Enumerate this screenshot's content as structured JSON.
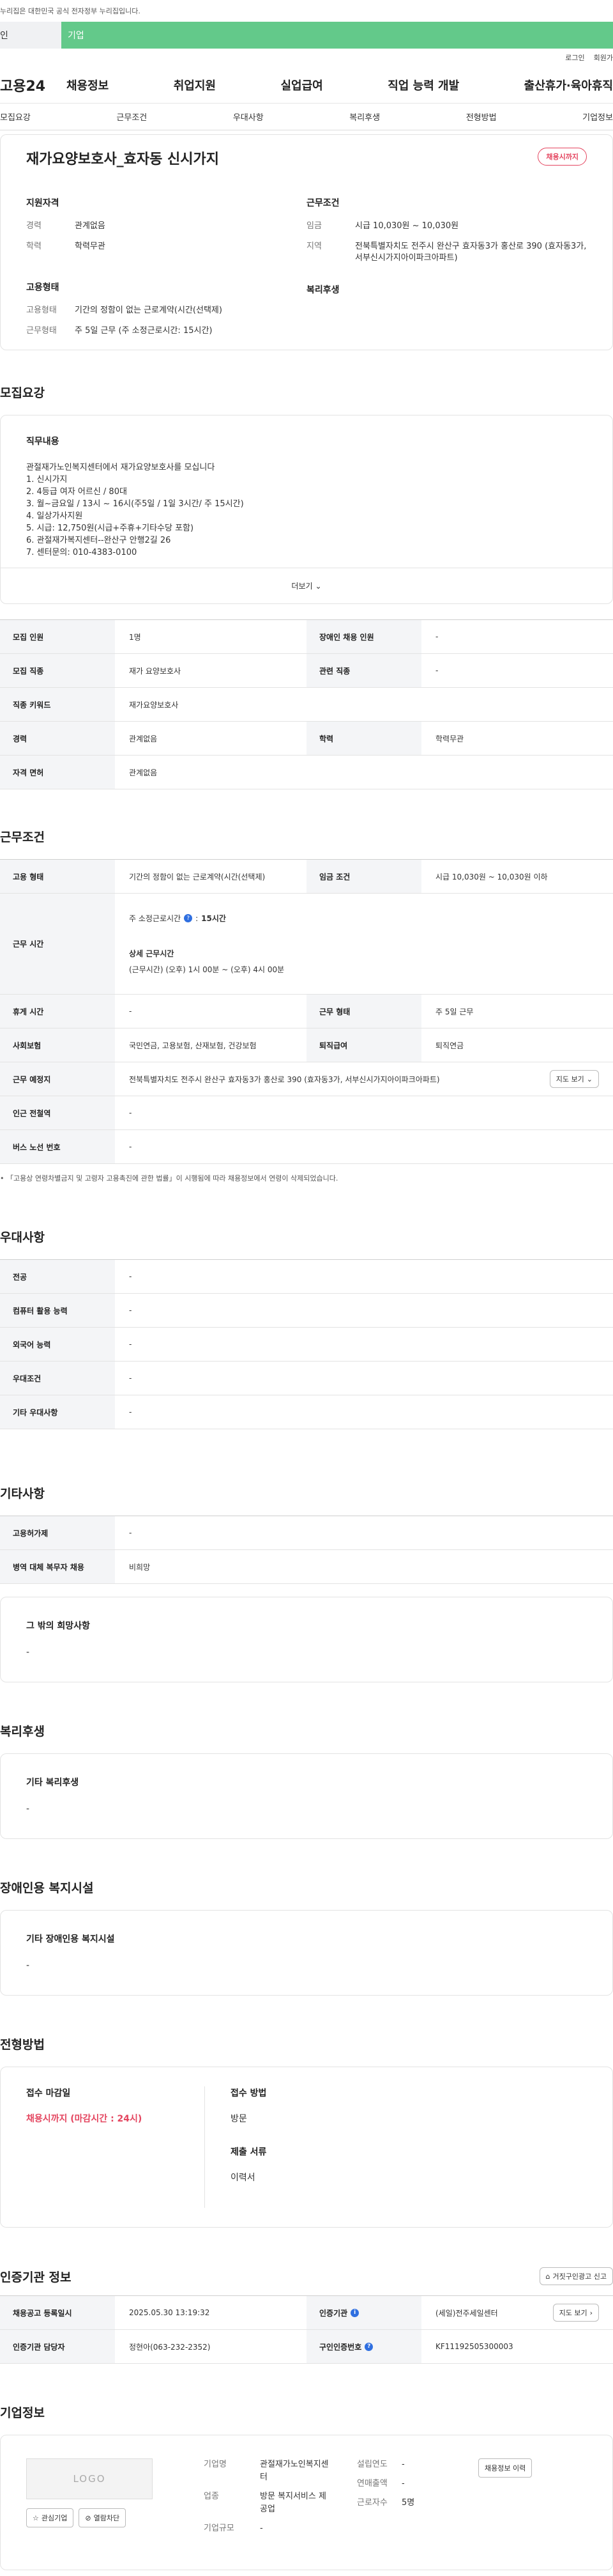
{
  "banner": {
    "text": "누리집은 대한민국 공식 전자정부 누리집입니다."
  },
  "user_tabs": {
    "personal": "인",
    "company": "기업"
  },
  "util": {
    "login": "로그인",
    "join": "회원가"
  },
  "gnb": {
    "logo": "고용24",
    "items": [
      "채용정보",
      "취업지원",
      "실업급여",
      "직업 능력 개발",
      "출산휴가·육아휴직"
    ]
  },
  "subnav": {
    "items": [
      "모집요강",
      "근무조건",
      "우대사항",
      "복리후생",
      "전형방법",
      "기업정보"
    ]
  },
  "summary": {
    "title": "재가요양보호사_효자동 신시가지",
    "badge": "채용시까지",
    "qual_title": "지원자격",
    "qual": [
      {
        "k": "경력",
        "v": "관계없음"
      },
      {
        "k": "학력",
        "v": "학력무관"
      }
    ],
    "work_title": "근무조건",
    "work": [
      {
        "k": "임금",
        "v": "시급 10,030원 ~ 10,030원"
      },
      {
        "k": "지역",
        "v": "전북특별자치도 전주시 완산구 효자동3가 홍산로 390 (효자동3가, 서부신시가지아이파크아파트)"
      }
    ],
    "emp_title": "고용형태",
    "emp": [
      {
        "k": "고용형태",
        "v": "기간의 정함이 없는 근로계약(시간(선택제)"
      },
      {
        "k": "근무형태",
        "v": "주 5일 근무 (주 소정근로시간: 15시간)"
      }
    ],
    "welfare_title": "복리후생"
  },
  "recruit": {
    "section": "모집요강",
    "desc_title": "직무내용",
    "desc_lines": [
      "관절재가노인복지센터에서 재가요양보호사를 모십니다",
      "1. 신시가지",
      "2. 4등급 여자 어르신 / 80대",
      "3. 월~금요일 / 13시 ~ 16시(주5일 / 1일 3시간/ 주 15시간)",
      "4. 일상가사지원",
      "5. 시급: 12,750원(시급+주휴+기타수당 포함)",
      "6. 관절재가복지센터--완산구 안행2길 26",
      "7. 센터문의: 010-4383-0100"
    ],
    "more": "더보기",
    "rows": [
      {
        "th1": "모집 인원",
        "td1": "1명",
        "th2": "장애인 채용 인원",
        "td2": "-"
      },
      {
        "th1": "모집 직종",
        "td1": "재가 요양보호사",
        "th2": "관련 직종",
        "td2": "-"
      },
      {
        "th1": "직종 키워드",
        "td1": "재가요양보호사"
      },
      {
        "th1": "경력",
        "td1": "관계없음",
        "th2": "학력",
        "td2": "학력무관"
      },
      {
        "th1": "자격 면허",
        "td1": "관계없음"
      }
    ]
  },
  "conditions": {
    "section": "근무조건",
    "emp_type_th": "고용 형태",
    "emp_type": "기간의 정함이 없는 근로계약(시간(선택제)",
    "wage_th": "임금 조건",
    "wage": "시급 10,030원 ~ 10,030원 이하",
    "hours_th": "근무 시간",
    "weekly_label": "주 소정근로시간",
    "weekly_value": "15시간",
    "detail_label": "상세 근무시간",
    "detail_value": "(근무시간) (오후) 1시 00분 ~ (오후) 4시 00분",
    "break_th": "휴게 시간",
    "break": "-",
    "form_th": "근무 형태",
    "form": "주 5일 근무",
    "insurance_th": "사회보험",
    "insurance": "국민연금, 고용보험, 산재보험, 건강보험",
    "severance_th": "퇴직급여",
    "severance": "퇴직연금",
    "location_th": "근무 예정지",
    "location": "전북특별자치도 전주시 완산구 효자동3가 홍산로 390 (효자동3가, 서부신시가지아이파크아파트)",
    "map_btn": "지도 보기",
    "subway_th": "인근 전철역",
    "subway": "-",
    "bus_th": "버스 노선 번호",
    "bus": "-",
    "note": "「고용상 연령차별금지 및 고령자 고용촉진에 관한 법률」이 시행됨에 따라 채용정보에서 연령이 삭제되었습니다."
  },
  "preference": {
    "section": "우대사항",
    "rows": [
      {
        "th": "전공",
        "td": "-"
      },
      {
        "th": "컴퓨터 활용 능력",
        "td": "-"
      },
      {
        "th": "외국어 능력",
        "td": "-"
      },
      {
        "th": "우대조건",
        "td": "-"
      },
      {
        "th": "기타 우대사항",
        "td": "-"
      }
    ]
  },
  "etc": {
    "section": "기타사항",
    "rows": [
      {
        "th": "고용허가제",
        "td": "-"
      },
      {
        "th": "병역 대체 복무자 채용",
        "td": "비희망"
      }
    ],
    "other_title": "그 밖의 희망사항",
    "other_value": "-"
  },
  "welfare": {
    "section": "복리후생",
    "title": "기타 복리후생",
    "value": "-"
  },
  "disability": {
    "section": "장애인용 복지시설",
    "title": "기타 장애인용 복지시설",
    "value": "-"
  },
  "process": {
    "section": "전형방법",
    "deadline_title": "접수 마감일",
    "deadline_value": "채용시까지 (마감시간 : 24시)",
    "method_title": "접수 방법",
    "method_value": "방문",
    "docs_title": "제출 서류",
    "docs_value": "이력서"
  },
  "certification": {
    "section": "인증기관 정보",
    "report_btn": "거짓구인광고 신고",
    "reg_th": "채용공고 등록일시",
    "reg": "2025.05.30 13:19:32",
    "agency_th": "인증기관",
    "agency": "(세일)전주세일센터",
    "map_btn": "지도 보기",
    "manager_th": "인증기관 담당자",
    "manager": "정현아(063-232-2352)",
    "job_no_th": "구인인증번호",
    "job_no": "KF11192505300003"
  },
  "company": {
    "section": "기업정보",
    "logo_text": "LOGO",
    "fav_btn": "관심기업",
    "block_btn": "열람차단",
    "fields": [
      {
        "k": "기업명",
        "v": "관절재가노인복지센터"
      },
      {
        "k": "업종",
        "v": "방문 복지서비스 제공업"
      },
      {
        "k": "기업규모",
        "v": "-"
      }
    ],
    "fields2": [
      {
        "k": "설립연도",
        "v": "-"
      },
      {
        "k": "연매출액",
        "v": "-"
      },
      {
        "k": "근로자수",
        "v": "5명"
      }
    ],
    "detail_btn": "채용정보 이력"
  },
  "colors": {
    "accent_green": "#63c98a",
    "deadline_red": "#e4455f",
    "info_blue": "#2f6fe0"
  }
}
